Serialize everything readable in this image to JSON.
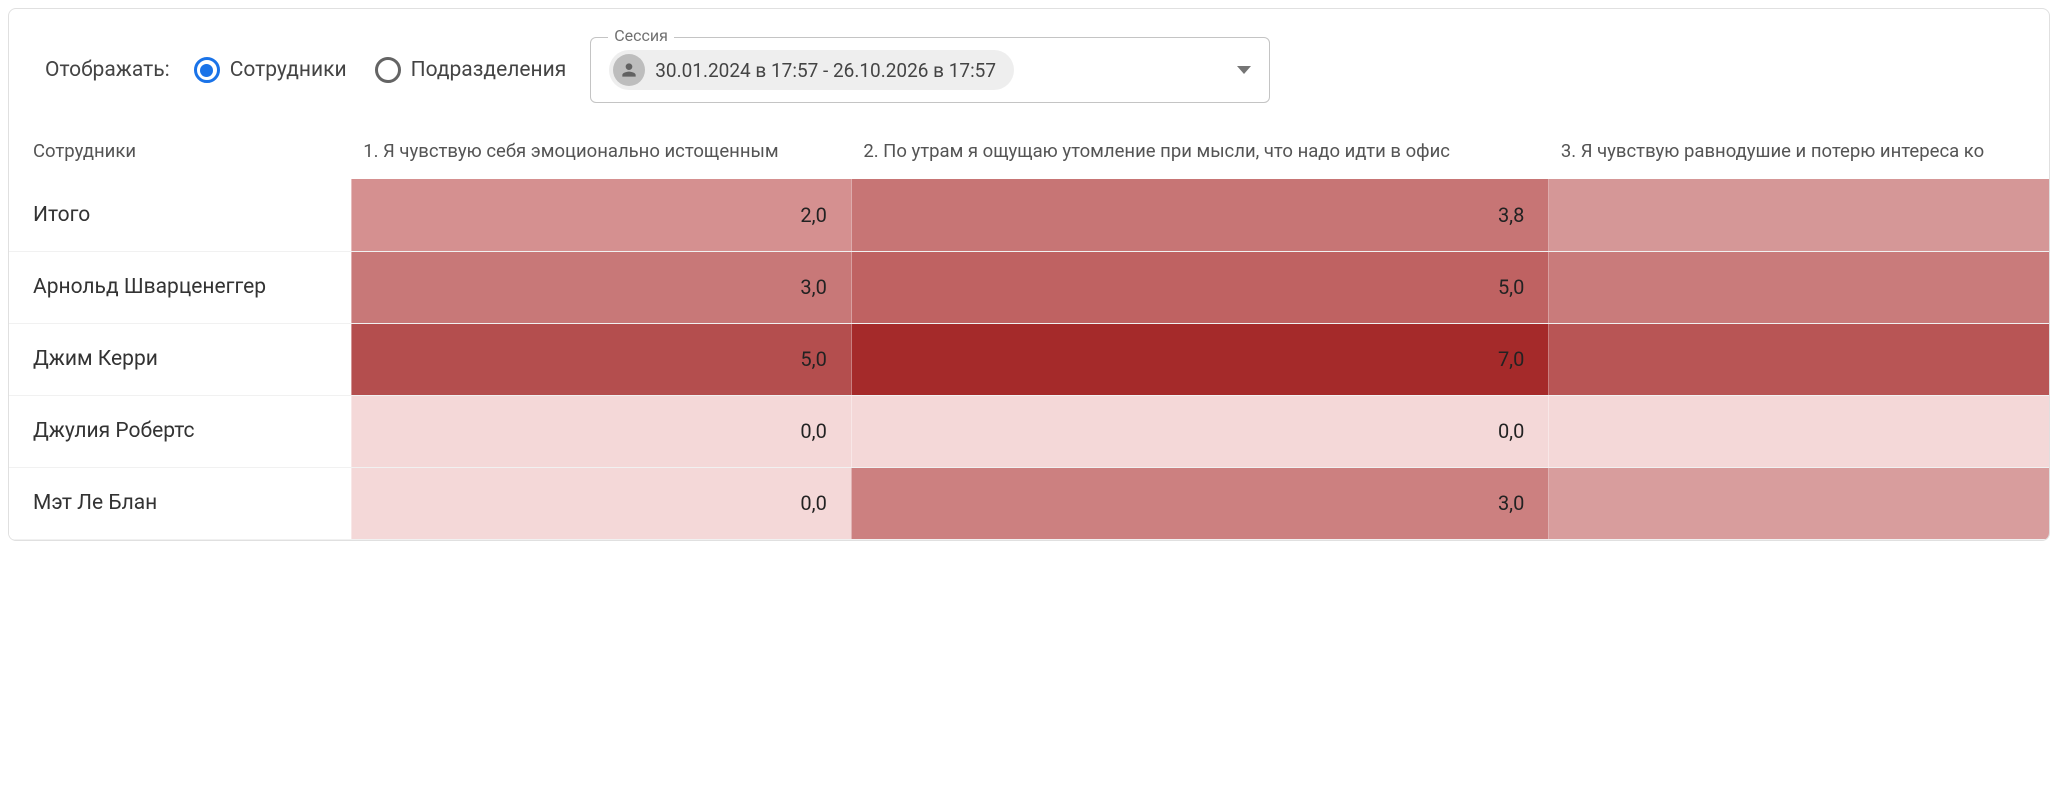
{
  "controls": {
    "display_label": "Отображать:",
    "radios": [
      {
        "label": "Сотрудники",
        "selected": true
      },
      {
        "label": "Подразделения",
        "selected": false
      }
    ],
    "session_fieldset_label": "Сессия",
    "session_chip": "30.01.2024 в 17:57 - 26.10.2026 в 17:57"
  },
  "table": {
    "row_header_label": "Сотрудники",
    "questions": [
      "1. Я чувствую себя эмоционально истощенным",
      "2. По утрам я ощущаю утомление при мысли, что надо идти в офис",
      "3. Я чувствую равнодушие и потерю интереса ко"
    ],
    "rows": [
      {
        "name": "Итого",
        "vals": [
          "2,0",
          "3,8",
          ""
        ]
      },
      {
        "name": "Арнольд Шварценеггер",
        "vals": [
          "3,0",
          "5,0",
          ""
        ]
      },
      {
        "name": "Джим Керри",
        "vals": [
          "5,0",
          "7,0",
          ""
        ]
      },
      {
        "name": "Джулия Робертс",
        "vals": [
          "0,0",
          "0,0",
          ""
        ]
      },
      {
        "name": "Мэт Ле Блан",
        "vals": [
          "0,0",
          "3,0",
          ""
        ]
      }
    ],
    "cell_colors": [
      [
        "#d59090",
        "#c77575",
        "#d59797"
      ],
      [
        "#c87878",
        "#bf6262",
        "#c97b7b"
      ],
      [
        "#b44e4e",
        "#a52a2a",
        "#b85555"
      ],
      [
        "#f4d8d8",
        "#f4d8d8",
        "#f4d8d8"
      ],
      [
        "#f4d8d8",
        "#cc8080",
        "#d89d9d"
      ]
    ]
  },
  "chart_data": {
    "type": "heatmap",
    "title": "",
    "row_labels": [
      "Итого",
      "Арнольд Шварценеггер",
      "Джим Керри",
      "Джулия Робертс",
      "Мэт Ле Блан"
    ],
    "col_labels": [
      "1. Я чувствую себя эмоционально истощенным",
      "2. По утрам я ощущаю утомление при мысли, что надо идти в офис",
      "3. Я чувствую равнодушие и потерю интереса ко"
    ],
    "values": [
      [
        2.0,
        3.8,
        null
      ],
      [
        3.0,
        5.0,
        null
      ],
      [
        5.0,
        7.0,
        null
      ],
      [
        0.0,
        0.0,
        null
      ],
      [
        0.0,
        3.0,
        null
      ]
    ],
    "value_range": [
      0,
      7
    ]
  }
}
